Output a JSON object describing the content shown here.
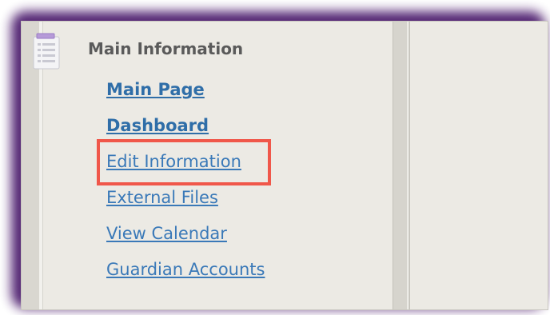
{
  "panel": {
    "title": "Main Information",
    "icon": "document-list-icon"
  },
  "links": [
    {
      "label": "Main Page",
      "bold": true
    },
    {
      "label": "Dashboard",
      "bold": true
    },
    {
      "label": "Edit Information",
      "bold": false,
      "highlighted": true
    },
    {
      "label": "External Files",
      "bold": false
    },
    {
      "label": "View Calendar",
      "bold": false
    },
    {
      "label": "Guardian Accounts",
      "bold": false
    }
  ],
  "colors": {
    "link": "#3a79b8",
    "highlight": "#f0574a",
    "frame_glow": "#4a1a6c",
    "panel_bg": "#eceae4"
  }
}
